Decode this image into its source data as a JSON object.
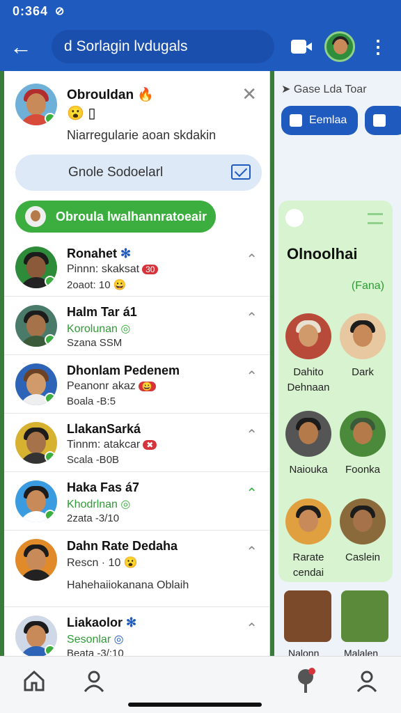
{
  "status": {
    "time": "0:364",
    "icons": [
      "bluetooth-icon",
      "signal-icon",
      "battery-icon"
    ]
  },
  "appbar": {
    "title": "d Sorlagin lvdugals"
  },
  "top_card": {
    "name": "Obrouldan",
    "description": "Niarregularie aoan skdakin",
    "bubble_text": "Gnole Sodoelarl",
    "green_pill": "Obroula lwalhannratoeair"
  },
  "contacts": [
    {
      "name": "Ronahet",
      "line2": "Pinnn: skaksat",
      "line3": "2oaot: 10",
      "line2_green": false,
      "pin_green": false
    },
    {
      "name": "Halm Tar á1",
      "line2": "Korolunan",
      "line3": "Szana SSM",
      "line2_green": true,
      "pin_green": false
    },
    {
      "name": "Dhonlam Pedenem",
      "line2": "Peanonr akaz",
      "line3": "Boala -B:5",
      "line2_green": false,
      "pin_green": false
    },
    {
      "name": "LlakanSarká",
      "line2": "Tinnm: atakcar",
      "line3": "Scala -B0B",
      "line2_green": false,
      "pin_green": false
    },
    {
      "name": "Haka Fas á7",
      "line2": "Khodrlnan",
      "line3": "2zata -3/10",
      "line2_green": true,
      "pin_green": true
    },
    {
      "name": "Dahn Rate Dedaha",
      "line2": "Rescn · 10",
      "line3": "",
      "line4": "Hahehaiiokanana Oblaih",
      "line2_green": false,
      "pin_green": false
    },
    {
      "name": "Liakaolor",
      "line2": "Sesonlar",
      "line3": "Beata -3/:10",
      "line2_green": true,
      "pin_green": false
    }
  ],
  "right_panel": {
    "header": "Gase Lda Toar",
    "button1": "Eemlaa",
    "card_title": "Olnoolhai",
    "card_sub": "(Fana)",
    "tiles": [
      {
        "label": "Dahito Dehnaan"
      },
      {
        "label": "Dark"
      },
      {
        "label": "Naiouka"
      },
      {
        "label": "Foonka"
      },
      {
        "label": "Rarate cendai"
      },
      {
        "label": "Caslein"
      }
    ],
    "games": [
      {
        "label": "Nalonn"
      },
      {
        "label": "Malalen"
      }
    ]
  },
  "bottomnav": {
    "icons": [
      "home-icon",
      "person-icon",
      "location-icon",
      "person-icon"
    ]
  }
}
